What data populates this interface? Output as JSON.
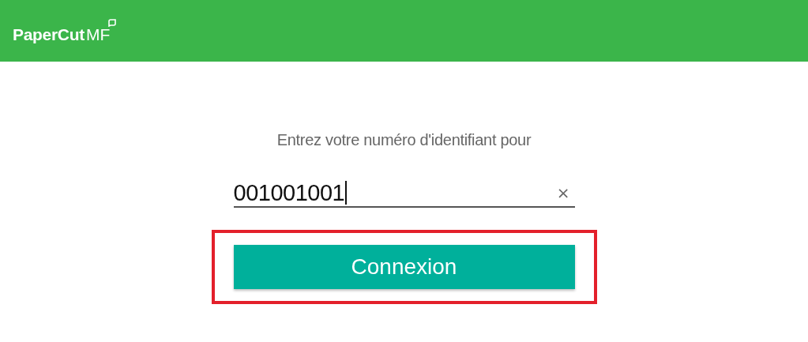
{
  "header": {
    "logo_text": "PaperCut",
    "logo_suffix": "MF"
  },
  "prompt": "Entrez votre numéro d'identifiant pour",
  "id_field": {
    "value": "001001001",
    "focused": true,
    "clear_label": "×"
  },
  "login_button": {
    "label": "Connexion",
    "highlighted": true
  }
}
